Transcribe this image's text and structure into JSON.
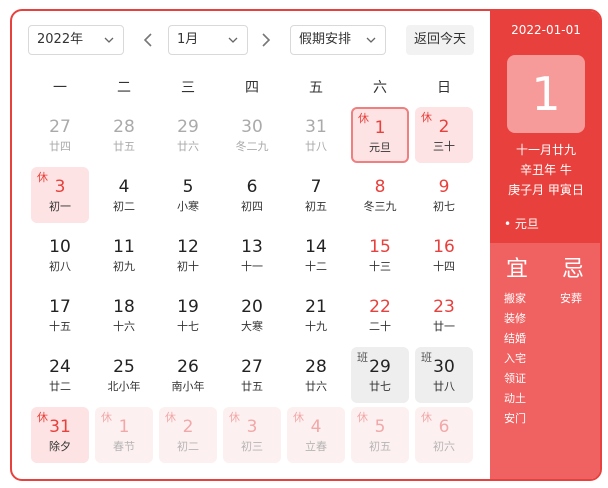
{
  "toolbar": {
    "year": "2022年",
    "month": "1月",
    "holiday": "假期安排",
    "today_button": "返回今天"
  },
  "weekdays": [
    "一",
    "二",
    "三",
    "四",
    "五",
    "六",
    "日"
  ],
  "weeks": [
    [
      {
        "day": "27",
        "lunar": "廿四",
        "dim": true
      },
      {
        "day": "28",
        "lunar": "廿五",
        "dim": true
      },
      {
        "day": "29",
        "lunar": "廿六",
        "dim": true
      },
      {
        "day": "30",
        "lunar": "冬二九",
        "dim": true
      },
      {
        "day": "31",
        "lunar": "廿八",
        "dim": true
      },
      {
        "day": "1",
        "lunar": "元旦",
        "tag": "休",
        "rest": true,
        "selected": true
      },
      {
        "day": "2",
        "lunar": "三十",
        "tag": "休",
        "rest": true
      }
    ],
    [
      {
        "day": "3",
        "lunar": "初一",
        "tag": "休",
        "rest": true
      },
      {
        "day": "4",
        "lunar": "初二"
      },
      {
        "day": "5",
        "lunar": "小寒"
      },
      {
        "day": "6",
        "lunar": "初四"
      },
      {
        "day": "7",
        "lunar": "初五"
      },
      {
        "day": "8",
        "lunar": "冬三九",
        "weekend": true
      },
      {
        "day": "9",
        "lunar": "初七",
        "weekend": true
      }
    ],
    [
      {
        "day": "10",
        "lunar": "初八"
      },
      {
        "day": "11",
        "lunar": "初九"
      },
      {
        "day": "12",
        "lunar": "初十"
      },
      {
        "day": "13",
        "lunar": "十一"
      },
      {
        "day": "14",
        "lunar": "十二"
      },
      {
        "day": "15",
        "lunar": "十三",
        "weekend": true
      },
      {
        "day": "16",
        "lunar": "十四",
        "weekend": true
      }
    ],
    [
      {
        "day": "17",
        "lunar": "十五"
      },
      {
        "day": "18",
        "lunar": "十六"
      },
      {
        "day": "19",
        "lunar": "十七"
      },
      {
        "day": "20",
        "lunar": "大寒"
      },
      {
        "day": "21",
        "lunar": "十九"
      },
      {
        "day": "22",
        "lunar": "二十",
        "weekend": true
      },
      {
        "day": "23",
        "lunar": "廿一",
        "weekend": true
      }
    ],
    [
      {
        "day": "24",
        "lunar": "廿二"
      },
      {
        "day": "25",
        "lunar": "北小年"
      },
      {
        "day": "26",
        "lunar": "南小年"
      },
      {
        "day": "27",
        "lunar": "廿五"
      },
      {
        "day": "28",
        "lunar": "廿六"
      },
      {
        "day": "29",
        "lunar": "廿七",
        "tag": "班",
        "work": true
      },
      {
        "day": "30",
        "lunar": "廿八",
        "tag": "班",
        "work": true
      }
    ],
    [
      {
        "day": "31",
        "lunar": "除夕",
        "tag": "休",
        "rest": true
      },
      {
        "day": "1",
        "lunar": "春节",
        "tag": "休",
        "rest": true,
        "dim": true
      },
      {
        "day": "2",
        "lunar": "初二",
        "tag": "休",
        "rest": true,
        "dim": true
      },
      {
        "day": "3",
        "lunar": "初三",
        "tag": "休",
        "rest": true,
        "dim": true
      },
      {
        "day": "4",
        "lunar": "立春",
        "tag": "休",
        "rest": true,
        "dim": true
      },
      {
        "day": "5",
        "lunar": "初五",
        "tag": "休",
        "rest": true,
        "dim": true
      },
      {
        "day": "6",
        "lunar": "初六",
        "tag": "休",
        "rest": true,
        "dim": true
      }
    ]
  ],
  "panel": {
    "date": "2022-01-01",
    "big_day": "1",
    "lunar_date": "十一月廿九",
    "year_ganzhi": "辛丑年 牛",
    "month_day_ganzhi": "庚子月 甲寅日",
    "festival": "• 元旦",
    "yi_title": "宜",
    "ji_title": "忌",
    "yi": [
      "搬家",
      "装修",
      "结婚",
      "入宅",
      "领证",
      "动土",
      "安门"
    ],
    "ji": [
      "安葬"
    ]
  },
  "colors": {
    "accent": "#e8403c",
    "rest_bg": "#fde3e3",
    "work_bg": "#eeeeee"
  }
}
